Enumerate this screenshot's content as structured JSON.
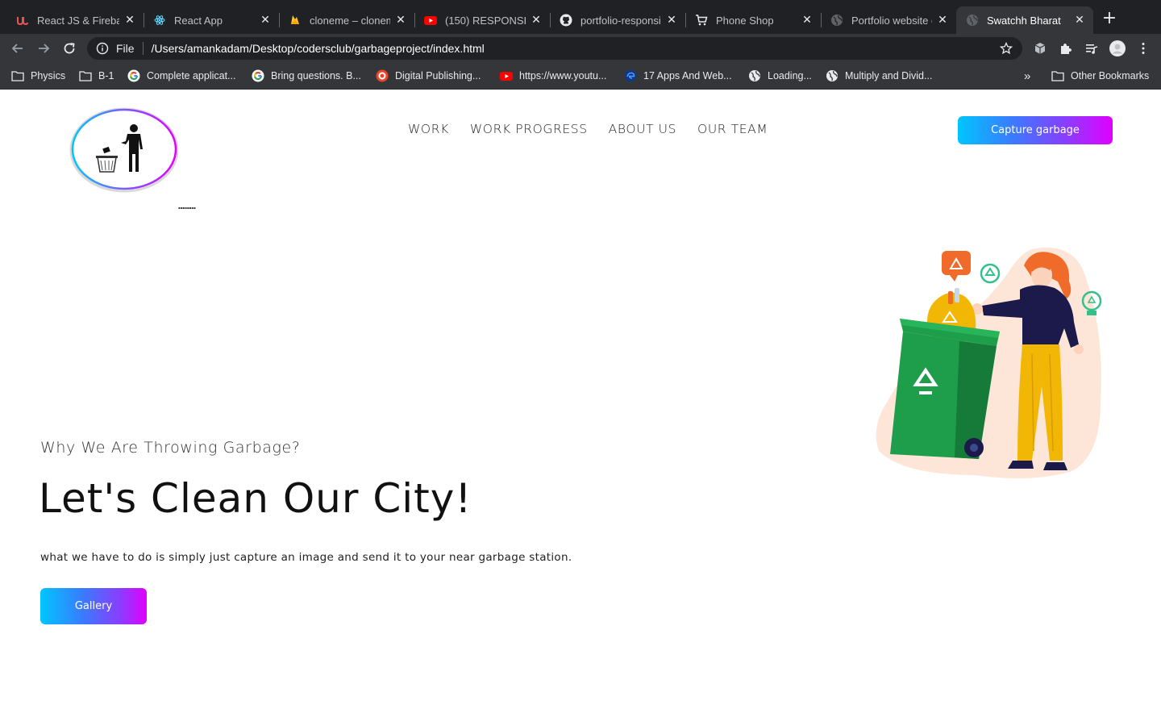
{
  "browser": {
    "tabs": [
      {
        "title": "React JS & Firebas",
        "icon": "udemy-icon",
        "active": false
      },
      {
        "title": "React App",
        "icon": "react-icon",
        "active": false
      },
      {
        "title": "cloneme – clonem",
        "icon": "firebase-icon",
        "active": false
      },
      {
        "title": "(150) RESPONSIVE",
        "icon": "youtube-icon",
        "active": false
      },
      {
        "title": "portfolio-responsi",
        "icon": "github-icon",
        "active": false
      },
      {
        "title": "Phone Shop",
        "icon": "cart-icon",
        "active": false
      },
      {
        "title": "Portfolio website c",
        "icon": "globe-icon",
        "active": false
      },
      {
        "title": "Swatchh Bharat",
        "icon": "globe-icon",
        "active": true
      }
    ],
    "address": {
      "scheme": "File",
      "url": "/Users/amankadam/Desktop/codersclub/garbageproject/index.html"
    },
    "bookmarks": [
      {
        "label": "Physics",
        "icon": "folder-icon"
      },
      {
        "label": "B-1",
        "icon": "folder-icon"
      },
      {
        "label": "Complete applicat...",
        "icon": "google-icon"
      },
      {
        "label": "Bring questions. B...",
        "icon": "google-icon"
      },
      {
        "label": "Digital Publishing...",
        "icon": "target-icon"
      },
      {
        "label": "https://www.youtu...",
        "icon": "youtube-icon"
      },
      {
        "label": "17 Apps And Web...",
        "icon": "edge-icon"
      },
      {
        "label": "Loading...",
        "icon": "globe-icon"
      },
      {
        "label": "Multiply and Divid...",
        "icon": "globe-icon"
      }
    ],
    "bookmarks_overflow": "»",
    "other_bookmarks": "Other Bookmarks"
  },
  "page": {
    "nav": [
      "WORK",
      "WORK PROGRESS",
      "ABOUT US",
      "OUR TEAM"
    ],
    "cta_label": "Capture garbage",
    "hero": {
      "subtitle": "Why We Are Throwing Garbage?",
      "title": "Let's Clean Our City!",
      "description": "what we have to do is simply just capture an image and send it to your near garbage station.",
      "button": "Gallery"
    }
  },
  "colors": {
    "chrome_dark": "#202124",
    "chrome_mid": "#35363a",
    "gradient_start": "#00c6ff",
    "gradient_end": "#e100ff",
    "bin_green": "#1e9e4a",
    "bag_yellow": "#f2b705",
    "shirt_navy": "#1b1a4a",
    "hair_orange": "#f06a2a"
  }
}
